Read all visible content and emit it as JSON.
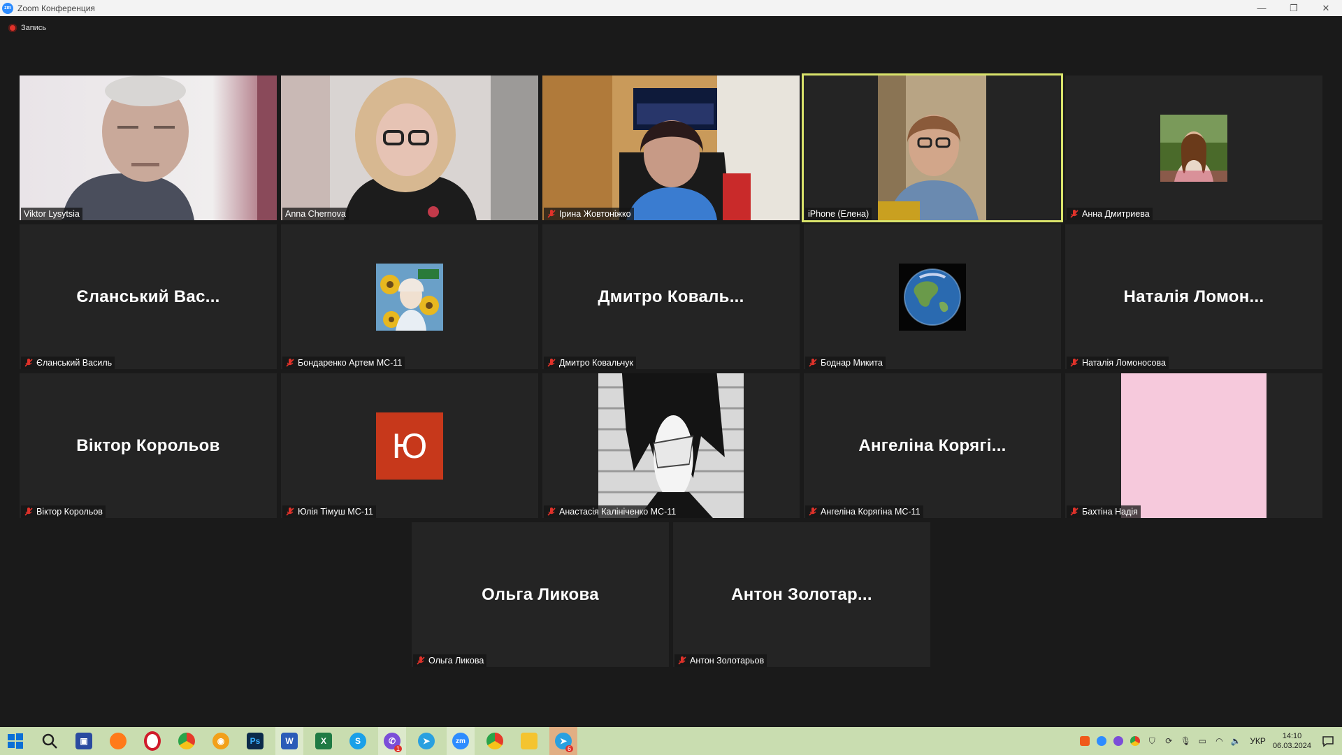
{
  "window": {
    "title": "Zoom Конференция"
  },
  "recording": {
    "label": "Запись"
  },
  "participants": [
    {
      "id": "viktor-lysytsia",
      "label": "Viktor Lysytsia",
      "muted": false,
      "display": "video"
    },
    {
      "id": "anna-chernova",
      "label": "Anna Chernova",
      "muted": false,
      "display": "video"
    },
    {
      "id": "iryna-zhovtonizhko",
      "label": "Ірина Жовтоніжко",
      "muted": true,
      "display": "video"
    },
    {
      "id": "iphone-elena",
      "label": "iPhone (Елена)",
      "muted": false,
      "display": "video",
      "active_speaker": true
    },
    {
      "id": "anna-dmytrieva",
      "label": "Анна Дмитриева",
      "muted": true,
      "display": "photo"
    },
    {
      "id": "yelanskyi-vasyl",
      "label": "Єланський Василь",
      "big_name": "Єланський  Вас...",
      "muted": true,
      "display": "name"
    },
    {
      "id": "bondarenko-artem",
      "label": "Бондаренко Артем МС-11",
      "muted": true,
      "display": "photo"
    },
    {
      "id": "dmytro-kovalchuk",
      "label": "Дмитро Ковальчук",
      "big_name": "Дмитро  Коваль...",
      "muted": true,
      "display": "name"
    },
    {
      "id": "bodnar-mykyta",
      "label": "Боднар Микита",
      "muted": true,
      "display": "globe"
    },
    {
      "id": "natalia-lomonosova",
      "label": "Наталія Ломоносова",
      "big_name": "Наталія  Ломон...",
      "muted": true,
      "display": "name"
    },
    {
      "id": "viktor-korolyov",
      "label": "Віктор Корольов",
      "big_name": "Віктор Корольов",
      "muted": true,
      "display": "name"
    },
    {
      "id": "yulia-timush",
      "label": "Юлія Тімуш МС-11",
      "avatar_letter": "Ю",
      "muted": true,
      "display": "letter"
    },
    {
      "id": "anastasia-kalinichenko",
      "label": "Анастасія Калініченко МС-11",
      "muted": true,
      "display": "manga"
    },
    {
      "id": "angelina-koryagina",
      "label": "Ангеліна Корягіна МС-11",
      "big_name": "Ангеліна  Корягі...",
      "muted": true,
      "display": "name"
    },
    {
      "id": "bakhtina-nadia",
      "label": "Бахтіна Надія",
      "muted": true,
      "display": "pink"
    },
    {
      "id": "olga-lykova",
      "label": "Ольга Ликова",
      "big_name": "Ольга  Ликова",
      "muted": true,
      "display": "name"
    },
    {
      "id": "anton-zolotaryov",
      "label": "Антон Золотарьов",
      "big_name": "Антон  Золотар...",
      "muted": true,
      "display": "name"
    }
  ],
  "taskbar": {
    "apps": [
      "windows-start",
      "search",
      "floppy-app",
      "firefox",
      "opera",
      "chrome",
      "eye-app",
      "photoshop",
      "word",
      "excel",
      "skype",
      "viber",
      "telegram",
      "zoom",
      "chrome-2",
      "file-explorer",
      "telegram-2"
    ],
    "viber_badge": "1",
    "telegram_badge": "6",
    "language": "УКР",
    "time": "14:10",
    "date": "06.03.2024"
  },
  "colors": {
    "active_speaker_border": "#d9e36b",
    "mute_red": "#e0322a",
    "avatar_letter_bg": "#c7381b",
    "taskbar_bg": "#c9ddb0"
  }
}
